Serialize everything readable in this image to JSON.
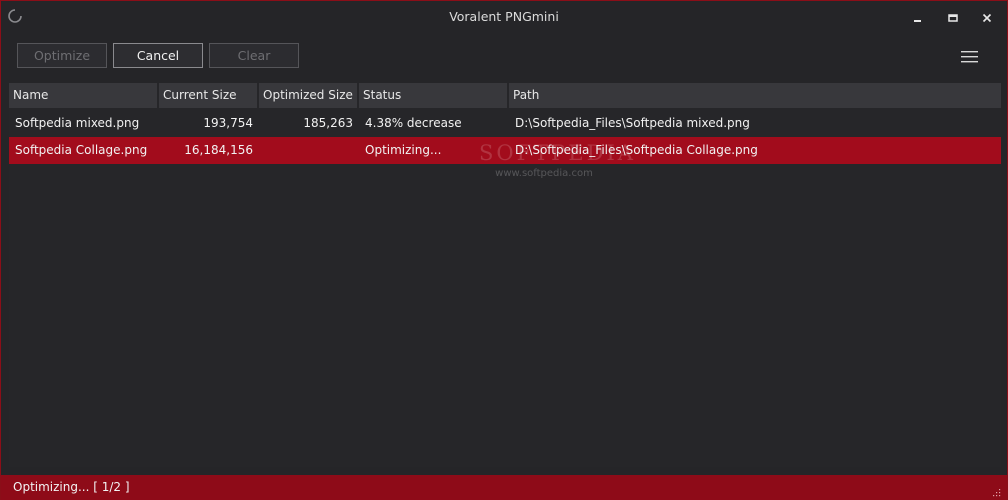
{
  "window": {
    "title": "Voralent PNGmini",
    "accent_color": "#a20c1c",
    "icons": {
      "app": "app-icon",
      "minimize": "minimize-icon",
      "maximize": "maximize-icon",
      "close": "close-icon",
      "menu": "hamburger-menu-icon",
      "grip": "resize-grip-icon"
    }
  },
  "toolbar": {
    "optimize_label": "Optimize",
    "cancel_label": "Cancel",
    "clear_label": "Clear"
  },
  "table": {
    "columns": [
      "Name",
      "Current Size",
      "Optimized Size",
      "Status",
      "Path"
    ],
    "rows": [
      {
        "name": "Softpedia mixed.png",
        "current_size": "193,754",
        "optimized_size": "185,263",
        "status": "4.38% decrease",
        "path": "D:\\Softpedia_Files\\Softpedia mixed.png",
        "selected": false
      },
      {
        "name": "Softpedia Collage.png",
        "current_size": "16,184,156",
        "optimized_size": "",
        "status": "Optimizing...",
        "path": "D:\\Softpedia_Files\\Softpedia Collage.png",
        "selected": true
      }
    ]
  },
  "watermark": {
    "text": "SOFTPEDIA",
    "url": "www.softpedia.com"
  },
  "statusbar": {
    "text": "Optimizing...  [ 1/2 ]"
  }
}
